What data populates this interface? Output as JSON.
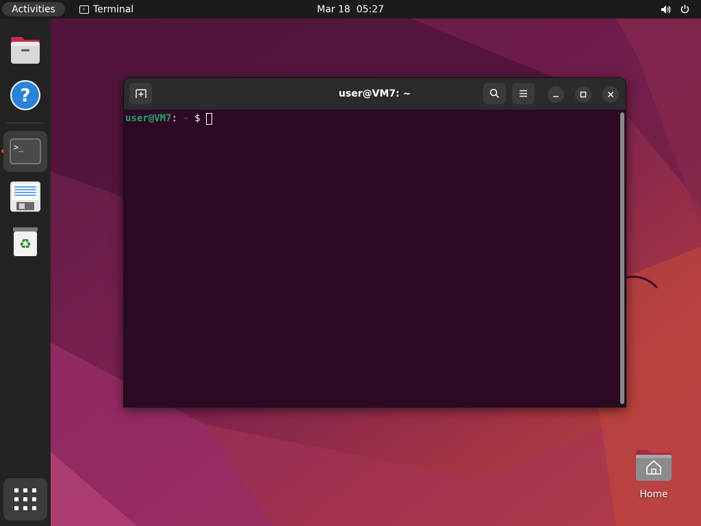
{
  "topbar": {
    "activities_label": "Activities",
    "app_name": "Terminal",
    "date": "Mar 18",
    "time": "05:27",
    "icons": [
      "volume-icon",
      "power-icon"
    ]
  },
  "dock": {
    "items": [
      {
        "name": "files",
        "icon": "files-icon"
      },
      {
        "name": "help",
        "icon": "help-icon"
      },
      {
        "name": "terminal",
        "icon": "terminal-icon",
        "active": true,
        "running": true
      },
      {
        "name": "text-editor",
        "icon": "text-editor-icon"
      },
      {
        "name": "trash",
        "icon": "trash-icon"
      }
    ],
    "apps_grid_icon": "show-apps-icon"
  },
  "terminal": {
    "title": "user@VM7: ~",
    "header_buttons": [
      "new-tab-icon",
      "search-icon",
      "menu-icon",
      "minimize-icon",
      "maximize-icon",
      "close-icon"
    ],
    "prompt": {
      "user_host": "user@VM7",
      "separator": ":",
      "path": " ~",
      "dollar": " $"
    },
    "colors": {
      "background": "#2c0a24",
      "prompt_user": "#26a269",
      "prompt_path": "#12488b"
    }
  },
  "desktop": {
    "home_label": "Home",
    "home_icon": "home-folder-icon"
  },
  "colors": {
    "topbar": "#1b1b1b",
    "dock": "#232323",
    "accent": "#e95420"
  }
}
